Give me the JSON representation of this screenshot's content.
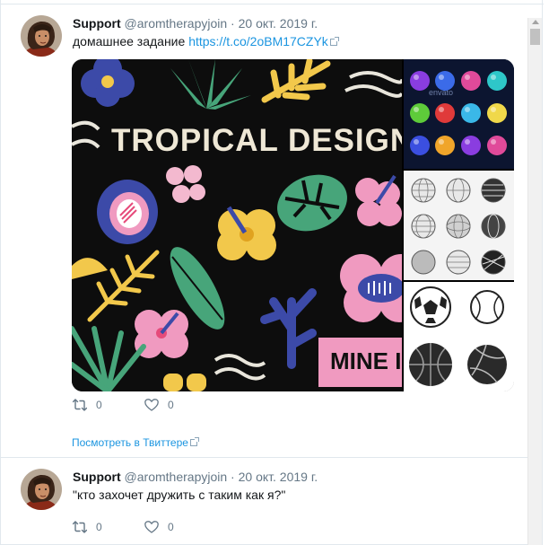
{
  "tweets": [
    {
      "name": "Support",
      "handle": "@aromtherapyjoin",
      "separator": "·",
      "date": "20 окт. 2019 г.",
      "text": "домашнее задание",
      "link": "https://t.co/2oBM17CZYk",
      "media_text": {
        "banner": "TROPICAL DESIGN E",
        "corner": "MINE I",
        "watermark": "envato"
      },
      "retweet_count": "0",
      "like_count": "0",
      "view_link": "Посмотреть в Твиттере"
    },
    {
      "name": "Support",
      "handle": "@aromtherapyjoin",
      "separator": "·",
      "date": "20 окт. 2019 г.",
      "text": "\"кто захочет дружить с таким как я?\"",
      "retweet_count": "0",
      "like_count": "0"
    }
  ],
  "colors": {
    "link": "#1b95e0",
    "muted": "#657786",
    "text": "#14171a",
    "border": "#e1e8ed"
  }
}
